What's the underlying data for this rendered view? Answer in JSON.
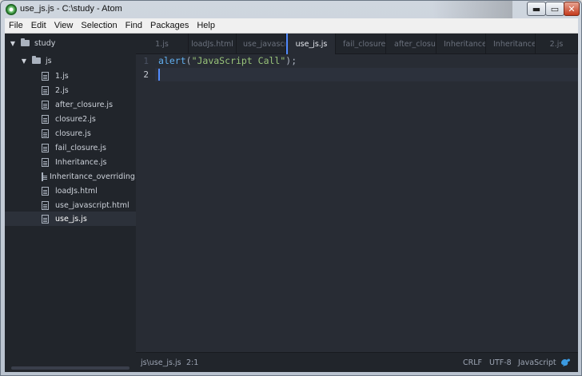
{
  "window": {
    "title": "use_js.js - C:\\study - Atom",
    "controls": {
      "minimize": "▬",
      "maximize": "▭",
      "close": "✕"
    }
  },
  "menu": [
    "File",
    "Edit",
    "View",
    "Selection",
    "Find",
    "Packages",
    "Help"
  ],
  "tree": {
    "root": "study",
    "folder": "js",
    "files": [
      "1.js",
      "2.js",
      "after_closure.js",
      "closure2.js",
      "closure.js",
      "fail_closure.js",
      "Inheritance.js",
      "Inheritance_overriding.js",
      "loadJs.html",
      "use_javascript.html",
      "use_js.js"
    ],
    "selected": "use_js.js"
  },
  "tabs": [
    "1.js",
    "loadJs.html",
    "use_javascript.html",
    "use_js.js",
    "fail_closure.js",
    "after_closure.js",
    "Inheritance.js",
    "Inheritance_overriding.js",
    "2.js"
  ],
  "active_tab": "use_js.js",
  "editor": {
    "line_numbers": [
      "1",
      "2"
    ],
    "code": {
      "fn": "alert",
      "open": "(",
      "str": "\"JavaScript Call\"",
      "close": ");"
    }
  },
  "status": {
    "path": "js\\use_js.js",
    "cursor": "2:1",
    "line_ending": "CRLF",
    "encoding": "UTF-8",
    "grammar": "JavaScript"
  },
  "colors": {
    "accent": "#528bff",
    "background": "#282c34",
    "panel": "#21252b"
  }
}
